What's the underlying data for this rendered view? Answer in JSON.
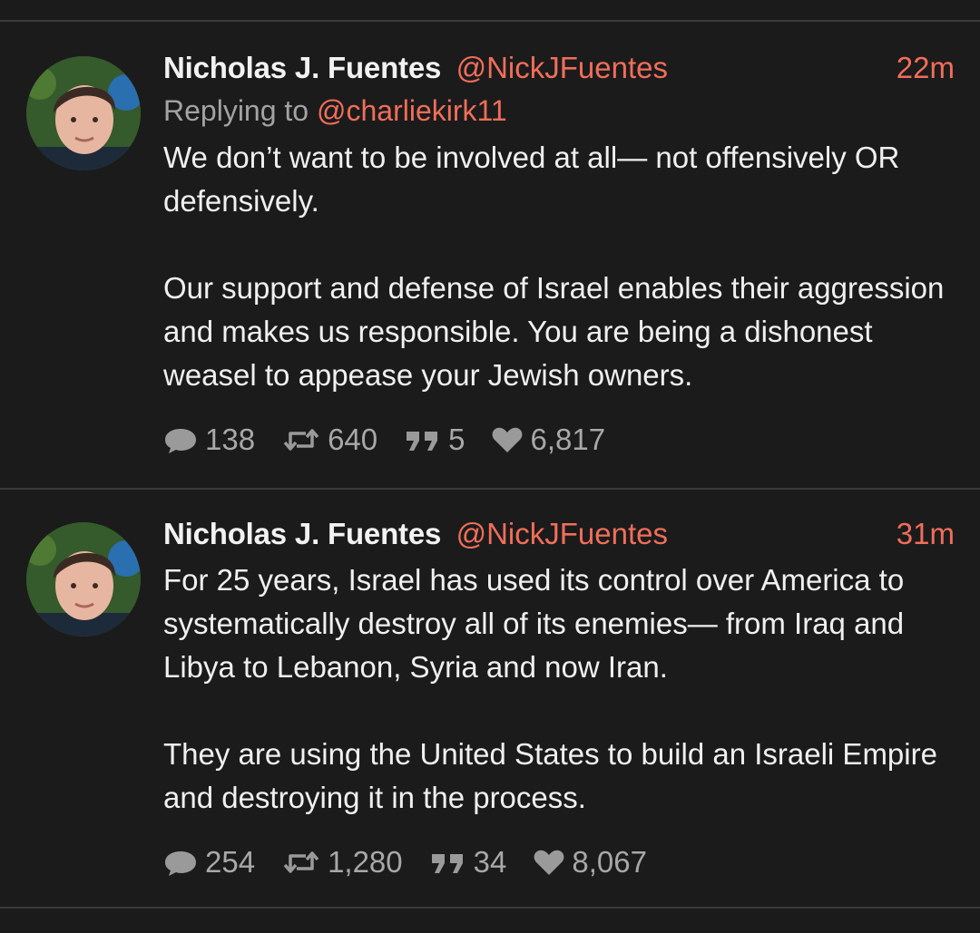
{
  "posts": [
    {
      "author": "Nicholas J. Fuentes",
      "handle": "@NickJFuentes",
      "time": "22m",
      "reply_prefix": "Replying to",
      "reply_to": "@charliekirk11",
      "paragraphs": [
        "We don’t want to be involved at all— not offensively OR defensively.",
        "Our support and defense of Israel enables their aggression and makes us responsible. You are being a dishonest weasel to appease your Jewish owners."
      ],
      "replies": "138",
      "reposts": "640",
      "quotes": "5",
      "likes": "6,817"
    },
    {
      "author": "Nicholas J. Fuentes",
      "handle": "@NickJFuentes",
      "time": "31m",
      "paragraphs": [
        "For 25 years, Israel has used its control over America to systematically destroy all of its enemies— from Iraq and Libya to Lebanon, Syria and now Iran.",
        "They are using the United States to build an Israeli Empire and destroying it in the process."
      ],
      "replies": "254",
      "reposts": "1,280",
      "quotes": "34",
      "likes": "8,067"
    }
  ],
  "icons": {
    "reply": "speech-bubble-icon",
    "repost": "repost-arrows-icon",
    "quote": "quote-marks-icon",
    "like": "heart-icon"
  },
  "colors": {
    "background": "#1b1b1b",
    "accent": "#f06e5a",
    "muted": "#a3a3a3",
    "divider": "#3a3a3a"
  }
}
